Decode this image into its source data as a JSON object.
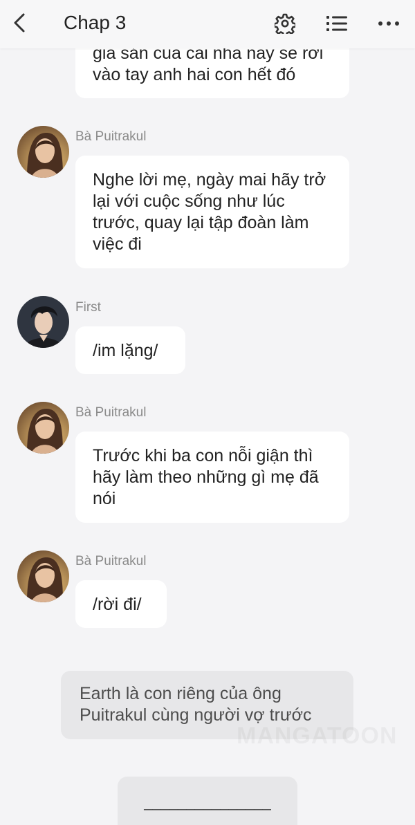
{
  "header": {
    "title": "Chap 3",
    "icons": [
      "back-arrow-icon",
      "gear-icon",
      "list-icon",
      "more-icon"
    ]
  },
  "messages": [
    {
      "text": "gia sản của cái nhà này sẽ rơi vào tay anh hai con hết đó"
    },
    {
      "name": "Bà Puitrakul",
      "text": "Nghe lời mẹ, ngày mai hãy trở lại với cuộc sống như lúc trước, quay lại tập đoàn làm việc đi"
    },
    {
      "name": "First",
      "text": "/im lặng/"
    },
    {
      "name": "Bà Puitrakul",
      "text": "Trước khi ba con nỗi giận thì hãy làm theo những gì mẹ đã nói"
    },
    {
      "name": "Bà Puitrakul",
      "text": "/rời đi/"
    }
  ],
  "narration": "Earth là con riêng của ông Puitrakul cùng người vợ trước",
  "watermark": "MANGATOON",
  "input": {
    "value": "_______________"
  }
}
